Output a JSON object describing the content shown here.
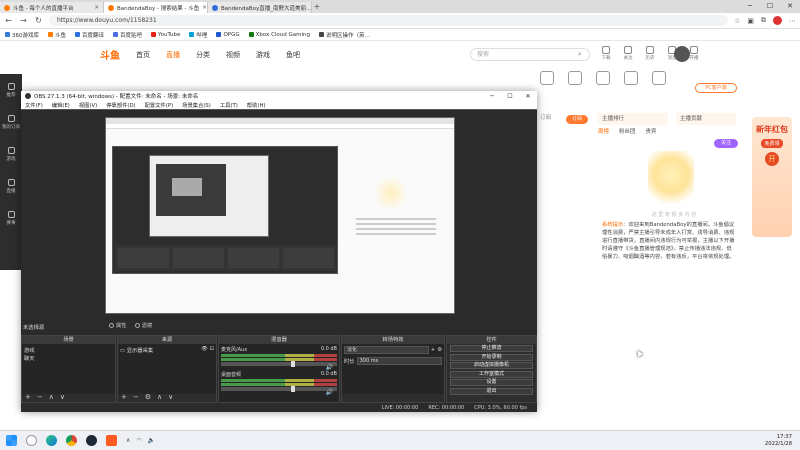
{
  "browser": {
    "tabs": [
      {
        "label": "斗鱼 - 每个人的直播平台",
        "active": false
      },
      {
        "label": "BandendaBoy - 搜索结果 - 斗鱼",
        "active": true
      },
      {
        "label": "BandendaBoy直播_南野大道美丽...",
        "active": false
      }
    ],
    "new_tab": "+",
    "window_controls": [
      "─",
      "☐",
      "✕"
    ],
    "url": "https://www.douyu.com/1158231",
    "bookmarks": [
      {
        "label": "360游戏库",
        "color": "#3a7bd5"
      },
      {
        "label": "斗鱼",
        "color": "#ff7a00"
      },
      {
        "label": "百度翻译",
        "color": "#2f6fde"
      },
      {
        "label": "百度贴吧",
        "color": "#4a6ee0"
      },
      {
        "label": "YouTube",
        "color": "#e62117"
      },
      {
        "label": "哔哩",
        "color": "#00a1d6"
      },
      {
        "label": "OPGG",
        "color": "#1f58d0"
      },
      {
        "label": "Xbox Cloud Gaming",
        "color": "#107c10"
      },
      {
        "label": "说明区操作（英...",
        "color": "#444444"
      }
    ]
  },
  "douyu": {
    "logo": "斗鱼",
    "nav": [
      {
        "label": "首页",
        "active": false
      },
      {
        "label": "直播",
        "active": true
      },
      {
        "label": "分类",
        "active": false
      },
      {
        "label": "视频",
        "active": false
      },
      {
        "label": "游戏",
        "active": false
      },
      {
        "label": "鱼吧",
        "active": false
      }
    ],
    "search_placeholder": "搜索",
    "top_icons": [
      "下载",
      "关注",
      "历史",
      "消息",
      "开播"
    ],
    "left_menu": [
      "推荐",
      "我的订阅",
      "游戏",
      "直播",
      "赛事"
    ],
    "pc_button": "PC客户端",
    "subscribe_label": "订阅",
    "sub_button": "订阅",
    "dropdown1": "主播排行",
    "dropdown2": "主播贡献",
    "right_tabs": [
      {
        "label": "周榜",
        "active": true
      },
      {
        "label": "粉丝团",
        "active": false
      },
      {
        "label": "贵宾",
        "active": false
      }
    ],
    "follow_btn": "关注",
    "mascot_note": "这 里 有 很 多 内 容",
    "chat_prefix": "系统提示：",
    "chat_text": "欢迎来到BandendaBoy的直播间。斗鱼倡议理性消费，严禁主播引导未成年人打赏、诱导消费、违规进行直播带货，直播间内违规行为可举报，主播以下开播时请遵守《斗鱼直播管理规范》，禁止传播违法违规、低俗暴力、吸烟酗酒等内容，若有违反，平台将依规处理。",
    "redpacket": {
      "title": "新年红包",
      "sub": "免费领",
      "key": "开"
    }
  },
  "obs": {
    "title": "OBS 27.1.3 (64-bit, windows) - 配置文件: 未命名 - 场景: 未命名",
    "window_controls": [
      "─",
      "☐",
      "✕"
    ],
    "menu": [
      "文件(F)",
      "编辑(E)",
      "视图(V)",
      "停靠部件(D)",
      "配置文件(P)",
      "场景集合(S)",
      "工具(T)",
      "帮助(H)"
    ],
    "source_label": "未选择源",
    "source_bar": [
      "属性",
      "滤镜"
    ],
    "docks": {
      "scenes": {
        "title": "场景",
        "items": [
          "游戏",
          "聊天"
        ]
      },
      "sources": {
        "title": "来源",
        "items": [
          "显示器采集"
        ]
      },
      "mixer": {
        "title": "混音器",
        "channels": [
          {
            "name": "麦克风/Aux",
            "db": "0.0 dB"
          },
          {
            "name": "桌面音频",
            "db": "0.0 dB"
          }
        ]
      },
      "transitions": {
        "title": "转场特效",
        "type": "淡化",
        "duration_label": "时长",
        "duration": "300 ms"
      },
      "controls": {
        "title": "控件",
        "buttons": [
          "停止推流",
          "开始录制",
          "启动虚拟摄像机",
          "工作室模式",
          "设置",
          "退出"
        ]
      }
    },
    "status": {
      "live": "LIVE: 00:00:00",
      "rec": "REC: 00:00:00",
      "cpu": "CPU: 3.0%, 60.00 fps"
    }
  },
  "taskbar": {
    "time": "17:37",
    "date": "2022/1/28",
    "apps": [
      "windows-logo",
      "search",
      "edge",
      "chrome",
      "steam",
      "douyu"
    ]
  }
}
